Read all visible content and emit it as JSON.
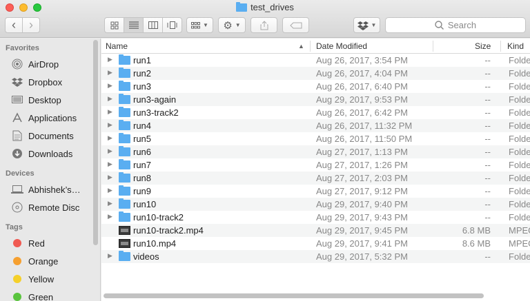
{
  "window": {
    "title": "test_drives"
  },
  "toolbar": {
    "back_label": "‹",
    "forward_label": "›",
    "search_placeholder": "Search"
  },
  "sidebar": {
    "favorites_title": "Favorites",
    "favorites": [
      {
        "label": "AirDrop",
        "icon": "airdrop-icon"
      },
      {
        "label": "Dropbox",
        "icon": "dropbox-icon"
      },
      {
        "label": "Desktop",
        "icon": "desktop-icon"
      },
      {
        "label": "Applications",
        "icon": "applications-icon"
      },
      {
        "label": "Documents",
        "icon": "documents-icon"
      },
      {
        "label": "Downloads",
        "icon": "downloads-icon"
      }
    ],
    "devices_title": "Devices",
    "devices": [
      {
        "label": "Abhishek’s…",
        "icon": "laptop-icon"
      },
      {
        "label": "Remote Disc",
        "icon": "disc-icon"
      }
    ],
    "tags_title": "Tags",
    "tags": [
      {
        "label": "Red",
        "color": "#f05a52"
      },
      {
        "label": "Orange",
        "color": "#f6a030"
      },
      {
        "label": "Yellow",
        "color": "#f5d02a"
      },
      {
        "label": "Green",
        "color": "#5ac43e"
      }
    ]
  },
  "list": {
    "columns": {
      "name": "Name",
      "date": "Date Modified",
      "size": "Size",
      "kind": "Kind"
    },
    "rows": [
      {
        "name": "run1",
        "date": "Aug 26, 2017, 3:54 PM",
        "size": "--",
        "kind": "Folder",
        "type": "folder"
      },
      {
        "name": "run2",
        "date": "Aug 26, 2017, 4:04 PM",
        "size": "--",
        "kind": "Folder",
        "type": "folder"
      },
      {
        "name": "run3",
        "date": "Aug 26, 2017, 6:40 PM",
        "size": "--",
        "kind": "Folder",
        "type": "folder"
      },
      {
        "name": "run3-again",
        "date": "Aug 29, 2017, 9:53 PM",
        "size": "--",
        "kind": "Folder",
        "type": "folder"
      },
      {
        "name": "run3-track2",
        "date": "Aug 26, 2017, 6:42 PM",
        "size": "--",
        "kind": "Folder",
        "type": "folder"
      },
      {
        "name": "run4",
        "date": "Aug 26, 2017, 11:32 PM",
        "size": "--",
        "kind": "Folder",
        "type": "folder"
      },
      {
        "name": "run5",
        "date": "Aug 26, 2017, 11:50 PM",
        "size": "--",
        "kind": "Folder",
        "type": "folder"
      },
      {
        "name": "run6",
        "date": "Aug 27, 2017, 1:13 PM",
        "size": "--",
        "kind": "Folder",
        "type": "folder"
      },
      {
        "name": "run7",
        "date": "Aug 27, 2017, 1:26 PM",
        "size": "--",
        "kind": "Folder",
        "type": "folder"
      },
      {
        "name": "run8",
        "date": "Aug 27, 2017, 2:03 PM",
        "size": "--",
        "kind": "Folder",
        "type": "folder"
      },
      {
        "name": "run9",
        "date": "Aug 27, 2017, 9:12 PM",
        "size": "--",
        "kind": "Folder",
        "type": "folder"
      },
      {
        "name": "run10",
        "date": "Aug 29, 2017, 9:40 PM",
        "size": "--",
        "kind": "Folder",
        "type": "folder"
      },
      {
        "name": "run10-track2",
        "date": "Aug 29, 2017, 9:43 PM",
        "size": "--",
        "kind": "Folder",
        "type": "folder"
      },
      {
        "name": "run10-track2.mp4",
        "date": "Aug 29, 2017, 9:45 PM",
        "size": "6.8 MB",
        "kind": "MPEG",
        "type": "video"
      },
      {
        "name": "run10.mp4",
        "date": "Aug 29, 2017, 9:41 PM",
        "size": "8.6 MB",
        "kind": "MPEG",
        "type": "video"
      },
      {
        "name": "videos",
        "date": "Aug 29, 2017, 5:32 PM",
        "size": "--",
        "kind": "Folder",
        "type": "folder"
      }
    ]
  }
}
